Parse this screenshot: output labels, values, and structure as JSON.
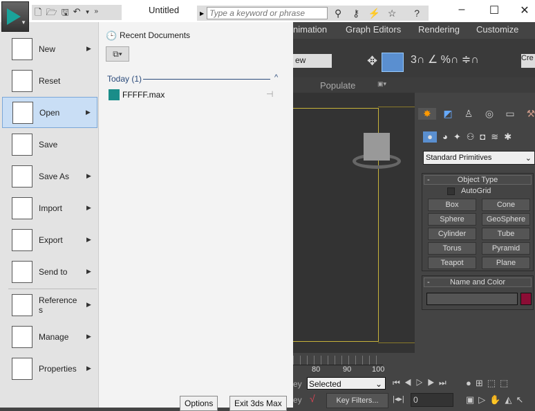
{
  "titlebar": {
    "title": "Untitled",
    "search_placeholder": "Type a keyword or phrase"
  },
  "menubar": [
    "nimation",
    "Graph Editors",
    "Rendering",
    "Customize"
  ],
  "ribbon": {
    "populate": "Populate"
  },
  "app_menu": {
    "items": [
      {
        "label": "New",
        "submenu": true
      },
      {
        "label": "Reset",
        "submenu": false
      },
      {
        "label": "Open",
        "submenu": true,
        "active": true
      },
      {
        "label": "Save",
        "submenu": false
      },
      {
        "label": "Save As",
        "submenu": true
      },
      {
        "label": "Import",
        "submenu": true
      },
      {
        "label": "Export",
        "submenu": true
      },
      {
        "label": "Send to",
        "submenu": true
      },
      {
        "label": "Reference\ns",
        "submenu": true
      },
      {
        "label": "Manage",
        "submenu": true
      },
      {
        "label": "Properties",
        "submenu": true
      }
    ],
    "recent_title": "Recent Documents",
    "group": "Today (1)",
    "files": [
      "FFFFF.max"
    ],
    "options": "Options",
    "exit": "Exit 3ds Max"
  },
  "command_panel": {
    "category": "Standard Primitives",
    "object_type": "Object Type",
    "autogrid": "AutoGrid",
    "buttons": [
      "Box",
      "Cone",
      "Sphere",
      "GeoSphere",
      "Cylinder",
      "Tube",
      "Torus",
      "Pyramid",
      "Teapot",
      "Plane"
    ],
    "name_color": "Name and Color",
    "color": "#8b0d35"
  },
  "timeline": {
    "ticks": [
      "80",
      "90",
      "100"
    ],
    "key_mode": "Selected",
    "key_filters": "Key Filters...",
    "frame": "0",
    "key_label": "ey"
  },
  "toolbar": {
    "view": "ew",
    "create_sel": "Cre"
  }
}
